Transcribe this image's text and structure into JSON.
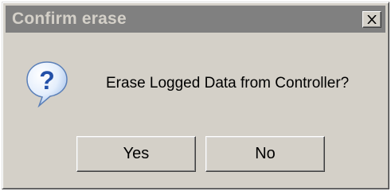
{
  "window": {
    "title": "Confirm erase",
    "close_icon": "close-x"
  },
  "message": {
    "icon": "question-icon",
    "text": "Erase Logged Data from Controller?"
  },
  "buttons": {
    "yes_label": "Yes",
    "no_label": "No"
  },
  "colors": {
    "dialog_bg": "#d4d0c8",
    "titlebar_bg": "#808080",
    "title_text": "#d4d0c8",
    "icon_blue": "#3a6fc4"
  }
}
